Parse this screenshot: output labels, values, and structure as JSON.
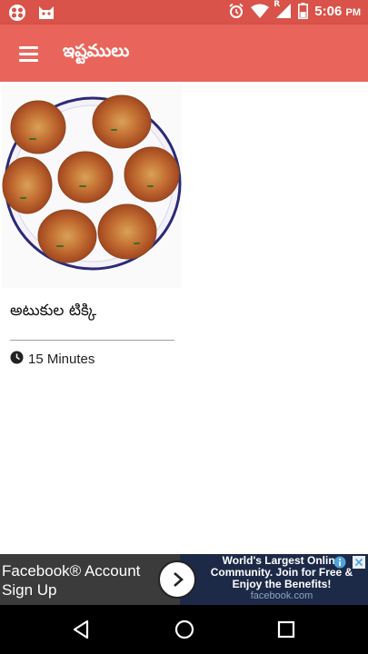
{
  "status_bar": {
    "time": "5:06",
    "time_suffix": "PM",
    "icons": [
      "notification-app-icon",
      "notification-cat-icon",
      "alarm-icon",
      "wifi-icon",
      "signal-icon",
      "battery-icon"
    ],
    "signal_letter": "R"
  },
  "app_bar": {
    "title": "ఇష్టములు",
    "menu_icon": "hamburger-menu-icon",
    "background": "#e9655b"
  },
  "recipes": [
    {
      "title": "అటుకుల టిక్కి",
      "time": "15 Minutes",
      "time_icon": "clock-icon"
    }
  ],
  "ad": {
    "headline": "Facebook® Account Sign Up",
    "body": "World's Largest Online Community. Join for Free & Enjoy the Benefits!",
    "url": "facebook.com",
    "cta_icon": "chevron-right-icon",
    "info_icon": "info-icon",
    "close_icon": "close-icon"
  },
  "nav_bar": {
    "buttons": [
      "back-icon",
      "home-icon",
      "recents-icon"
    ]
  },
  "colors": {
    "status_bar": "#d9534a",
    "app_bar": "#e9655b",
    "ad_left": "#3b3b3b",
    "ad_right": "#1d2a47"
  }
}
